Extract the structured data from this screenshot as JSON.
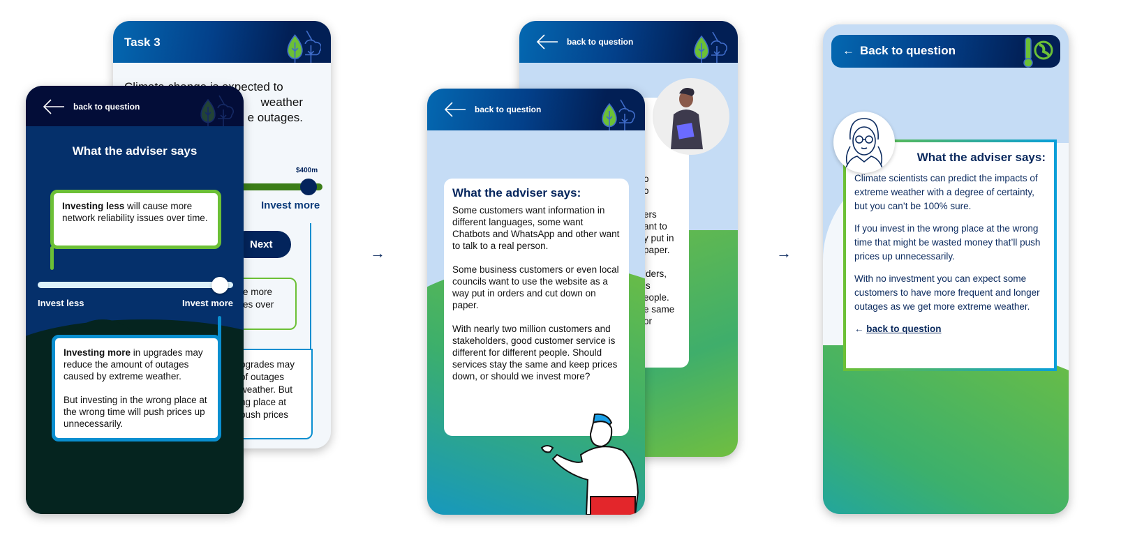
{
  "colors": {
    "navy": "#03245c",
    "green": "#6cc036",
    "blue": "#0a8fd0",
    "light_blue": "#c5dcf5"
  },
  "screen1_back": {
    "title": "Task 3",
    "question_lines": [
      "Climate change is expected to",
      "weather",
      "e outages."
    ],
    "slider_value": "$400m",
    "slider_fraction": 0.97,
    "invest_more": "Invest more",
    "next_label": "Next",
    "green_card_fragments": [
      "e more",
      "es over"
    ],
    "blue_card_fragments": [
      "pgrades may",
      "of outages",
      "weather. But",
      "ng place at",
      "push prices"
    ]
  },
  "screen1_front": {
    "back_label": "back to question",
    "heading": "What the adviser says",
    "less_card": {
      "bold": "Investing less",
      "text": " will cause more network reliability issues over time."
    },
    "slider_fraction": 0.96,
    "invest_less": "Invest less",
    "invest_more": "Invest more",
    "more_card": {
      "bold": "Investing more",
      "text": " in upgrades may reduce the amount of outages caused by extreme weather.",
      "p2": "But investing in the wrong place at the wrong time will push prices up unnecessarily."
    }
  },
  "screen2_back": {
    "back_label": "back to question",
    "card_fragments": [
      "o",
      "o",
      "",
      "ers",
      "ant to",
      "y put in",
      "paper.",
      "",
      "lders,",
      "is",
      "eople.",
      "e same",
      "or"
    ]
  },
  "screen2_front": {
    "back_label": "back to question",
    "heading": "What the adviser says:",
    "paragraphs": [
      "Some customers want information in different languages, some want Chatbots and WhatsApp and other want to talk to a real person.",
      "Some business customers or even local councils want to use the website as a way put in orders and cut down on paper.",
      "With nearly two million customers and stakeholders, good customer service is different for different people. Should services stay the same and keep prices down, or should we invest more?"
    ]
  },
  "screen3": {
    "back_label": "Back to question",
    "heading": "What the adviser says:",
    "paragraphs": [
      "Climate scientists can predict the impacts of extreme weather with a degree of certainty, but you can’t be 100% sure.",
      "If you invest in the wrong place at the wrong time that might be wasted money that’ll push prices up unnecessarily.",
      "With no investment you can expect some customers to have more frequent and longer outages as we get more extreme weather."
    ],
    "link_label": "back to question"
  },
  "flow_arrows": [
    "→",
    "→"
  ]
}
